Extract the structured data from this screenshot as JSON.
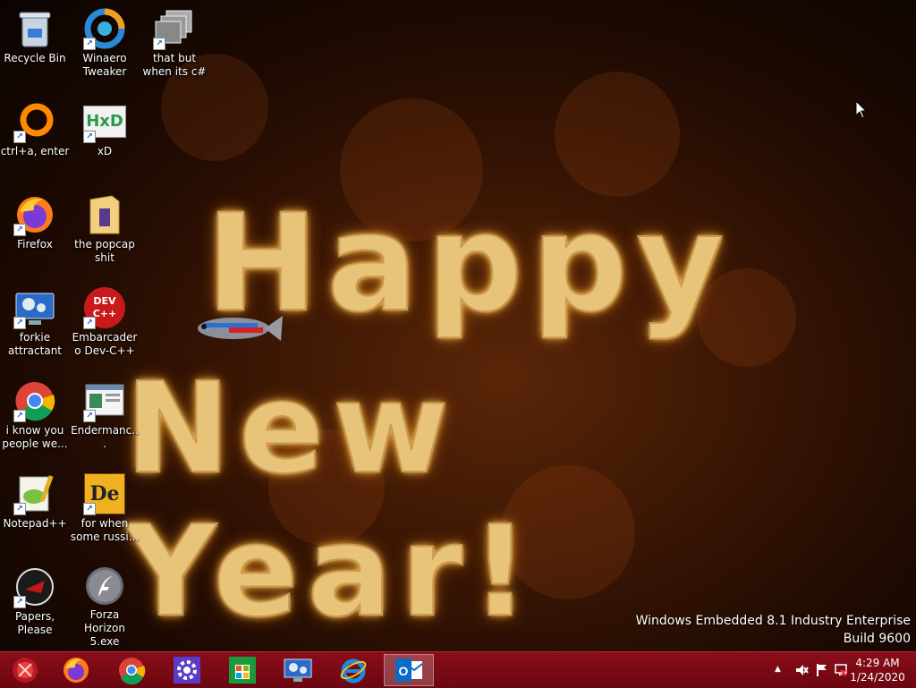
{
  "desktop": {
    "icons": [
      {
        "label": "Recycle Bin",
        "icon": "recycle-bin-icon"
      },
      {
        "label": "Winaero Tweaker",
        "icon": "winaero-tweaker-icon"
      },
      {
        "label": "that but when its c#",
        "icon": "windows-stack-icon"
      },
      {
        "label": "ctrl+a, enter",
        "icon": "orange-ring-icon"
      },
      {
        "label": "xD",
        "icon": "hxd-icon"
      },
      {
        "label": "Firefox",
        "icon": "firefox-icon"
      },
      {
        "label": "the popcap shit",
        "icon": "folder-icon"
      },
      {
        "label": "forkie attractant",
        "icon": "gear-monitor-icon"
      },
      {
        "label": "Embarcadero Dev-C++",
        "icon": "dev-cpp-icon"
      },
      {
        "label": "i know you people we...",
        "icon": "chrome-icon"
      },
      {
        "label": "Endermanc...",
        "icon": "window-app-icon"
      },
      {
        "label": "Notepad++",
        "icon": "notepad-plus-plus-icon"
      },
      {
        "label": "for when some russi...",
        "icon": "dependency-icon"
      },
      {
        "label": "Papers, Please",
        "icon": "papers-please-icon"
      },
      {
        "label": "Forza Horizon 5.exe",
        "icon": "flash-icon"
      }
    ],
    "devcpp_badge": "DEV C++",
    "xd_badge": "HxD",
    "de_badge": "De"
  },
  "wallpaper": {
    "line1": "Happy",
    "line2": "New Year!"
  },
  "watermark": {
    "line1": "Windows Embedded 8.1 Industry Enterprise",
    "line2": "Build 9600"
  },
  "taskbar": {
    "buttons": [
      {
        "name": "start",
        "icon": "start-orb-icon"
      },
      {
        "name": "firefox",
        "icon": "firefox-icon"
      },
      {
        "name": "chrome",
        "icon": "chrome-icon"
      },
      {
        "name": "settings",
        "icon": "gear-icon"
      },
      {
        "name": "store",
        "icon": "store-icon"
      },
      {
        "name": "control-panel",
        "icon": "gear-monitor-icon"
      },
      {
        "name": "internet-explorer",
        "icon": "ie-icon"
      },
      {
        "name": "outlook",
        "icon": "outlook-icon",
        "active": true
      }
    ],
    "tray": {
      "chevron": "▲",
      "clock_time": "4:29 AM",
      "clock_date": "1/24/2020"
    }
  },
  "colors": {
    "taskbar": "#7a0a14",
    "greeting": "#e8c47a"
  }
}
